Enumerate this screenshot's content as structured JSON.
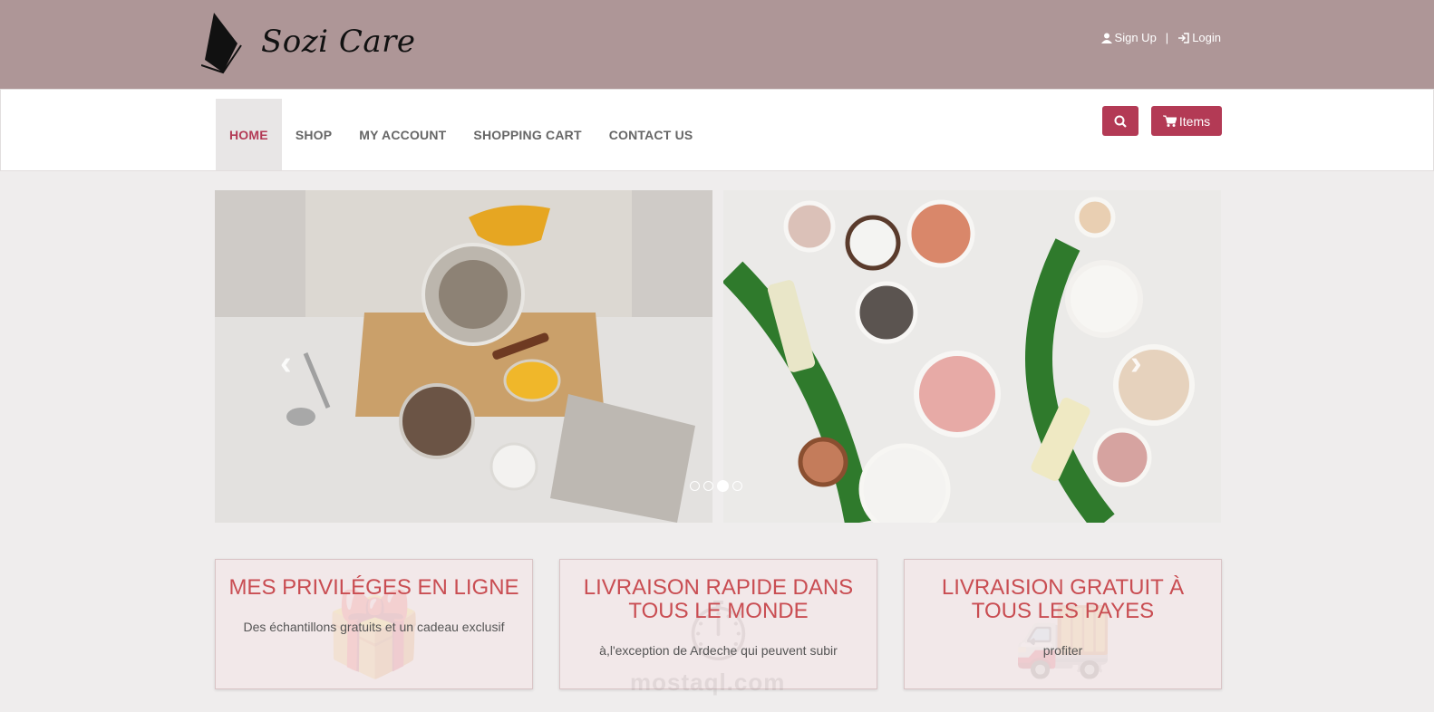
{
  "brand": {
    "name": "Sozi Care"
  },
  "auth": {
    "signup_label": "Sign Up",
    "separator": "|",
    "login_label": "Login"
  },
  "nav": {
    "items": [
      "HOME",
      "SHOP",
      "MY ACCOUNT",
      "SHOPPING CART",
      "CONTACT US"
    ],
    "active": "HOME"
  },
  "toolbar": {
    "cart_label": "Items"
  },
  "carousel": {
    "slides": 4,
    "active_index": 2,
    "prev_glyph": "‹",
    "next_glyph": "›"
  },
  "features": [
    {
      "title": "MES PRIVILÉGES EN LIGNE",
      "text": "Des échantillons gratuits et un cadeau exclusif"
    },
    {
      "title": "LIVRAISON RAPIDE DANS TOUS LE MONDE",
      "text": "à,l'exception de Ardeche qui peuvent subir"
    },
    {
      "title": "LIVRAISION GRATUIT À TOUS LES PAYES",
      "text": "profiter"
    }
  ],
  "watermark": "mostaql.com",
  "colors": {
    "topbar": "#ae9697",
    "accent": "#b33a55",
    "feature_title": "#c94d52"
  }
}
